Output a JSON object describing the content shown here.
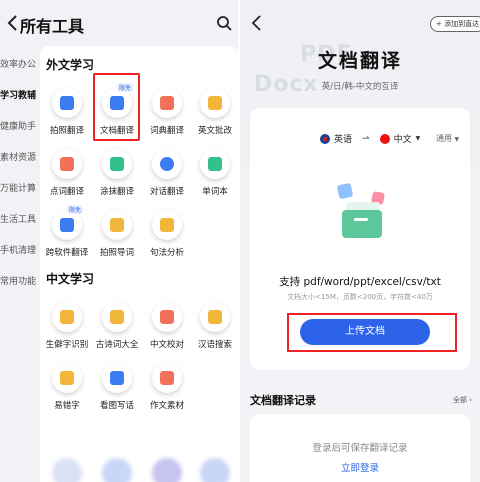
{
  "left": {
    "header": {
      "title": "所有工具"
    },
    "sidebar": [
      {
        "label": "效率办公",
        "active": false
      },
      {
        "label": "学习教辅",
        "active": true
      },
      {
        "label": "健康助手",
        "active": false
      },
      {
        "label": "素材资源",
        "active": false
      },
      {
        "label": "万能计算",
        "active": false
      },
      {
        "label": "生活工具",
        "active": false
      },
      {
        "label": "手机清理",
        "active": false
      },
      {
        "label": "常用功能",
        "active": false
      }
    ],
    "sections": {
      "foreign": {
        "title": "外文学习",
        "tools": [
          {
            "label": "拍照翻译"
          },
          {
            "label": "文档翻译",
            "badge": "限免"
          },
          {
            "label": "词典翻译"
          },
          {
            "label": "英文批改"
          },
          {
            "label": "点词翻译"
          },
          {
            "label": "涂抹翻译"
          },
          {
            "label": "对话翻译"
          },
          {
            "label": "单词本"
          },
          {
            "label": "跨软件翻译",
            "badge": "限免"
          },
          {
            "label": "拍照导词"
          },
          {
            "label": "句法分析"
          }
        ]
      },
      "chinese": {
        "title": "中文学习",
        "tools": [
          {
            "label": "生僻字识别"
          },
          {
            "label": "古诗词大全"
          },
          {
            "label": "中文校对"
          },
          {
            "label": "汉语搜索"
          },
          {
            "label": "易错字"
          },
          {
            "label": "看图写话"
          },
          {
            "label": "作文素材"
          }
        ]
      }
    }
  },
  "right": {
    "add_button": "+ 添加到直达",
    "watermark_a": "PDF",
    "watermark_b": "Docx",
    "title": "文档翻译",
    "subtitle": "英/日/韩-中文的互译",
    "lang_from": "英语",
    "lang_to": "中文",
    "mode": "通用",
    "support_text": "支持 pdf/word/ppt/excel/csv/txt",
    "limit_text": "文档大小<15M，页数<200页，字符数<40万",
    "upload_button": "上传文档",
    "records_title": "文档翻译记录",
    "records_all": "全部",
    "records_empty": "登录后可保存翻译记录",
    "login_link": "立即登录"
  },
  "colors": {
    "accent": "#2c63e8",
    "highlight": "#e22222"
  }
}
